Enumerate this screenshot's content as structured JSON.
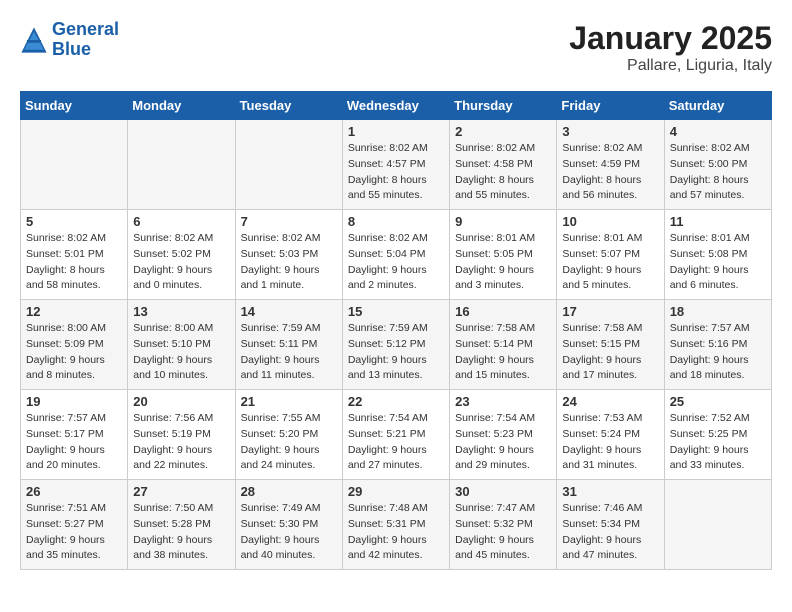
{
  "header": {
    "logo_line1": "General",
    "logo_line2": "Blue",
    "title": "January 2025",
    "subtitle": "Pallare, Liguria, Italy"
  },
  "weekdays": [
    "Sunday",
    "Monday",
    "Tuesday",
    "Wednesday",
    "Thursday",
    "Friday",
    "Saturday"
  ],
  "weeks": [
    [
      {
        "day": "",
        "info": ""
      },
      {
        "day": "",
        "info": ""
      },
      {
        "day": "",
        "info": ""
      },
      {
        "day": "1",
        "info": "Sunrise: 8:02 AM\nSunset: 4:57 PM\nDaylight: 8 hours\nand 55 minutes."
      },
      {
        "day": "2",
        "info": "Sunrise: 8:02 AM\nSunset: 4:58 PM\nDaylight: 8 hours\nand 55 minutes."
      },
      {
        "day": "3",
        "info": "Sunrise: 8:02 AM\nSunset: 4:59 PM\nDaylight: 8 hours\nand 56 minutes."
      },
      {
        "day": "4",
        "info": "Sunrise: 8:02 AM\nSunset: 5:00 PM\nDaylight: 8 hours\nand 57 minutes."
      }
    ],
    [
      {
        "day": "5",
        "info": "Sunrise: 8:02 AM\nSunset: 5:01 PM\nDaylight: 8 hours\nand 58 minutes."
      },
      {
        "day": "6",
        "info": "Sunrise: 8:02 AM\nSunset: 5:02 PM\nDaylight: 9 hours\nand 0 minutes."
      },
      {
        "day": "7",
        "info": "Sunrise: 8:02 AM\nSunset: 5:03 PM\nDaylight: 9 hours\nand 1 minute."
      },
      {
        "day": "8",
        "info": "Sunrise: 8:02 AM\nSunset: 5:04 PM\nDaylight: 9 hours\nand 2 minutes."
      },
      {
        "day": "9",
        "info": "Sunrise: 8:01 AM\nSunset: 5:05 PM\nDaylight: 9 hours\nand 3 minutes."
      },
      {
        "day": "10",
        "info": "Sunrise: 8:01 AM\nSunset: 5:07 PM\nDaylight: 9 hours\nand 5 minutes."
      },
      {
        "day": "11",
        "info": "Sunrise: 8:01 AM\nSunset: 5:08 PM\nDaylight: 9 hours\nand 6 minutes."
      }
    ],
    [
      {
        "day": "12",
        "info": "Sunrise: 8:00 AM\nSunset: 5:09 PM\nDaylight: 9 hours\nand 8 minutes."
      },
      {
        "day": "13",
        "info": "Sunrise: 8:00 AM\nSunset: 5:10 PM\nDaylight: 9 hours\nand 10 minutes."
      },
      {
        "day": "14",
        "info": "Sunrise: 7:59 AM\nSunset: 5:11 PM\nDaylight: 9 hours\nand 11 minutes."
      },
      {
        "day": "15",
        "info": "Sunrise: 7:59 AM\nSunset: 5:12 PM\nDaylight: 9 hours\nand 13 minutes."
      },
      {
        "day": "16",
        "info": "Sunrise: 7:58 AM\nSunset: 5:14 PM\nDaylight: 9 hours\nand 15 minutes."
      },
      {
        "day": "17",
        "info": "Sunrise: 7:58 AM\nSunset: 5:15 PM\nDaylight: 9 hours\nand 17 minutes."
      },
      {
        "day": "18",
        "info": "Sunrise: 7:57 AM\nSunset: 5:16 PM\nDaylight: 9 hours\nand 18 minutes."
      }
    ],
    [
      {
        "day": "19",
        "info": "Sunrise: 7:57 AM\nSunset: 5:17 PM\nDaylight: 9 hours\nand 20 minutes."
      },
      {
        "day": "20",
        "info": "Sunrise: 7:56 AM\nSunset: 5:19 PM\nDaylight: 9 hours\nand 22 minutes."
      },
      {
        "day": "21",
        "info": "Sunrise: 7:55 AM\nSunset: 5:20 PM\nDaylight: 9 hours\nand 24 minutes."
      },
      {
        "day": "22",
        "info": "Sunrise: 7:54 AM\nSunset: 5:21 PM\nDaylight: 9 hours\nand 27 minutes."
      },
      {
        "day": "23",
        "info": "Sunrise: 7:54 AM\nSunset: 5:23 PM\nDaylight: 9 hours\nand 29 minutes."
      },
      {
        "day": "24",
        "info": "Sunrise: 7:53 AM\nSunset: 5:24 PM\nDaylight: 9 hours\nand 31 minutes."
      },
      {
        "day": "25",
        "info": "Sunrise: 7:52 AM\nSunset: 5:25 PM\nDaylight: 9 hours\nand 33 minutes."
      }
    ],
    [
      {
        "day": "26",
        "info": "Sunrise: 7:51 AM\nSunset: 5:27 PM\nDaylight: 9 hours\nand 35 minutes."
      },
      {
        "day": "27",
        "info": "Sunrise: 7:50 AM\nSunset: 5:28 PM\nDaylight: 9 hours\nand 38 minutes."
      },
      {
        "day": "28",
        "info": "Sunrise: 7:49 AM\nSunset: 5:30 PM\nDaylight: 9 hours\nand 40 minutes."
      },
      {
        "day": "29",
        "info": "Sunrise: 7:48 AM\nSunset: 5:31 PM\nDaylight: 9 hours\nand 42 minutes."
      },
      {
        "day": "30",
        "info": "Sunrise: 7:47 AM\nSunset: 5:32 PM\nDaylight: 9 hours\nand 45 minutes."
      },
      {
        "day": "31",
        "info": "Sunrise: 7:46 AM\nSunset: 5:34 PM\nDaylight: 9 hours\nand 47 minutes."
      },
      {
        "day": "",
        "info": ""
      }
    ]
  ]
}
